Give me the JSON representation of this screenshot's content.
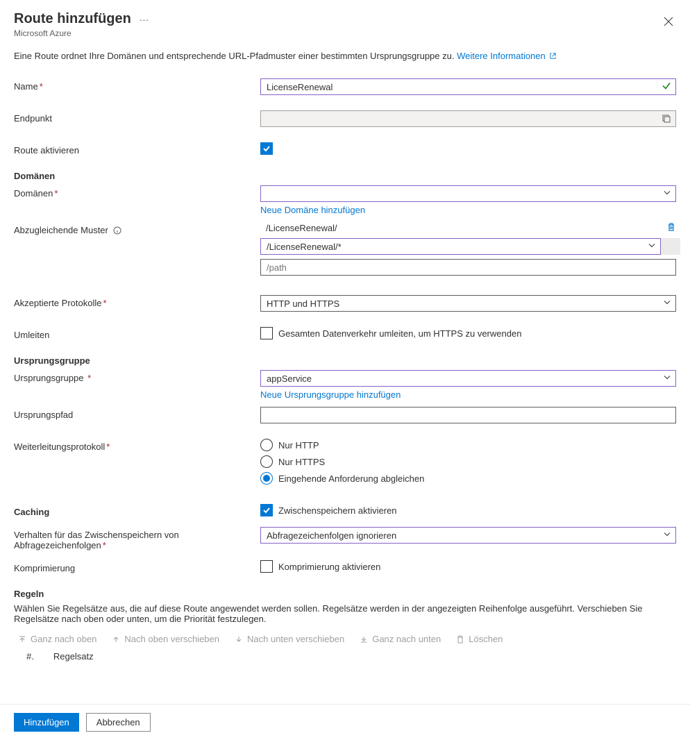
{
  "header": {
    "title": "Route hinzufügen",
    "subtitle": "Microsoft Azure"
  },
  "intro": {
    "text": "Eine Route ordnet Ihre Domänen und entsprechende URL-Pfadmuster einer bestimmten Ursprungsgruppe zu.",
    "link": "Weitere Informationen"
  },
  "fields": {
    "name_label": "Name",
    "name_value": "LicenseRenewal",
    "endpoint_label": "Endpunkt",
    "enable_route_label": "Route aktivieren"
  },
  "domains": {
    "section": "Domänen",
    "label": "Domänen",
    "add_link": "Neue Domäne hinzufügen"
  },
  "patterns": {
    "label": "Abzugleichende Muster",
    "item1": "/LicenseRenewal/",
    "item2": "/LicenseRenewal/*",
    "placeholder": "/path"
  },
  "protocols": {
    "label": "Akzeptierte Protokolle",
    "value": "HTTP und HTTPS"
  },
  "redirect": {
    "label": "Umleiten",
    "checkbox_label": "Gesamten Datenverkehr umleiten, um HTTPS zu verwenden"
  },
  "origin": {
    "section": "Ursprungsgruppe",
    "label": "Ursprungsgruppe",
    "value": "appService",
    "add_link": "Neue Ursprungsgruppe hinzufügen",
    "path_label": "Ursprungspfad",
    "fwd_label": "Weiterleitungsprotokoll",
    "radio1": "Nur HTTP",
    "radio2": "Nur HTTPS",
    "radio3": "Eingehende Anforderung abgleichen"
  },
  "caching": {
    "label": "Caching",
    "checkbox_label": "Zwischenspeichern aktivieren",
    "qs_label": "Verhalten für das Zwischenspeichern von Abfragezeichenfolgen",
    "qs_value": "Abfragezeichenfolgen ignorieren",
    "compress_label": "Komprimierung",
    "compress_checkbox": "Komprimierung aktivieren"
  },
  "rules": {
    "section": "Regeln",
    "desc": "Wählen Sie Regelsätze aus, die auf diese Route angewendet werden sollen. Regelsätze werden in der angezeigten Reihenfolge ausgeführt. Verschieben Sie Regelsätze nach oben oder unten, um die Priorität festzulegen.",
    "toolbar": {
      "top": "Ganz nach oben",
      "up": "Nach oben verschieben",
      "down": "Nach unten verschieben",
      "bottom": "Ganz nach unten",
      "delete": "Löschen"
    },
    "col_num": "#.",
    "col_ruleset": "Regelsatz"
  },
  "footer": {
    "add": "Hinzufügen",
    "cancel": "Abbrechen"
  }
}
